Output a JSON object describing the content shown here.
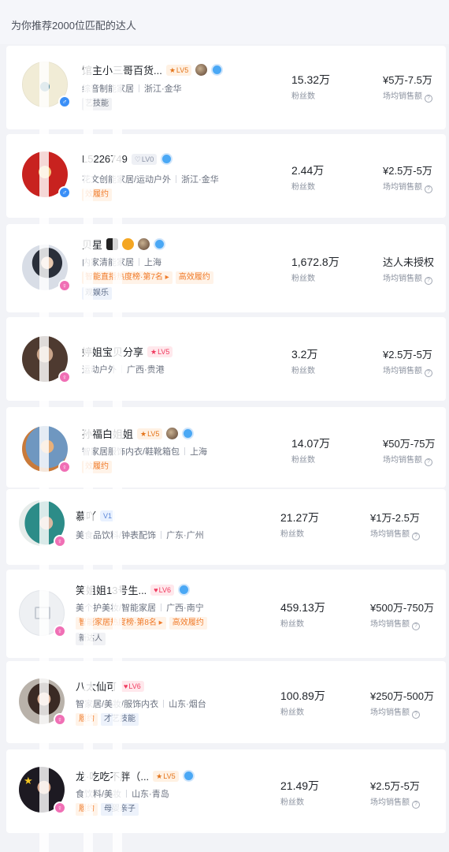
{
  "header": {
    "title": "为你推荐2000位匹配的达人"
  },
  "labels": {
    "fans": "粉丝数",
    "sales": "场均销售额"
  },
  "items": [
    {
      "name": "馆主小三哥百货...",
      "level": "LV5",
      "cat": "综音制能家居",
      "region": "浙江·金华",
      "tag1": "艺技能",
      "fans": "15.32万",
      "sales": "¥5万-7.5万",
      "gender": "♂"
    },
    {
      "name": "L5226749",
      "level": "LV0",
      "cat": "花文创能家居/运动户外",
      "region": "浙江·金华",
      "tag1": "效履约",
      "fans": "2.44万",
      "sales": "¥2.5万-5万",
      "gender": "♂"
    },
    {
      "name": "贝星",
      "level": "",
      "cat": "内家清能家居",
      "region": "上海",
      "tag1": "智能直播热度榜·第7名",
      "tag2": "高效履约",
      "tag3": "观娱乐",
      "fans": "1,672.8万",
      "sales": "达人未授权",
      "gender": "♀"
    },
    {
      "name": "婷姐宝贝分享",
      "level": "LV5",
      "cat": "运动户外",
      "region": "广西·贵港",
      "fans": "3.2万",
      "sales": "¥2.5万-5万",
      "gender": "♀"
    },
    {
      "name": "孙福白姐姐",
      "level": "LV5",
      "cat": "智家居服饰内衣/鞋靴箱包",
      "region": "上海",
      "tag1": "效履约",
      "fans": "14.07万",
      "sales": "¥50万-75万",
      "gender": "♀"
    },
    {
      "name": "慕吖",
      "level": "V1",
      "cat": "美食品饮料/钟表配饰",
      "region": "广东·广州",
      "fans": "21.27万",
      "sales": "¥1万-2.5万",
      "gender": "♀"
    },
    {
      "name": "笑姐姐13号生...",
      "level": "LV6",
      "cat": "美个护美妆/智能家居",
      "region": "广西·南宁",
      "tag1": "智能家居热度榜·第8名",
      "tag2": "高效履约",
      "tag3": "新达人",
      "fans": "459.13万",
      "sales": "¥500万-750万",
      "gender": "♀"
    },
    {
      "name": "八太仙可",
      "level": "LV6",
      "cat": "智家居/美妆/服饰内衣",
      "region": "山东·烟台",
      "tag1": "履约",
      "tag2": "才艺技能",
      "fans": "100.89万",
      "sales": "¥250万-500万",
      "gender": "♀"
    },
    {
      "name": "龙·吃吃不胖（...",
      "level": "LV5",
      "cat": "食饮料/美妆",
      "region": "山东·青岛",
      "tag1": "履约",
      "tag2": "母婴亲子",
      "fans": "21.49万",
      "sales": "¥2.5万-5万",
      "gender": "♀"
    }
  ]
}
